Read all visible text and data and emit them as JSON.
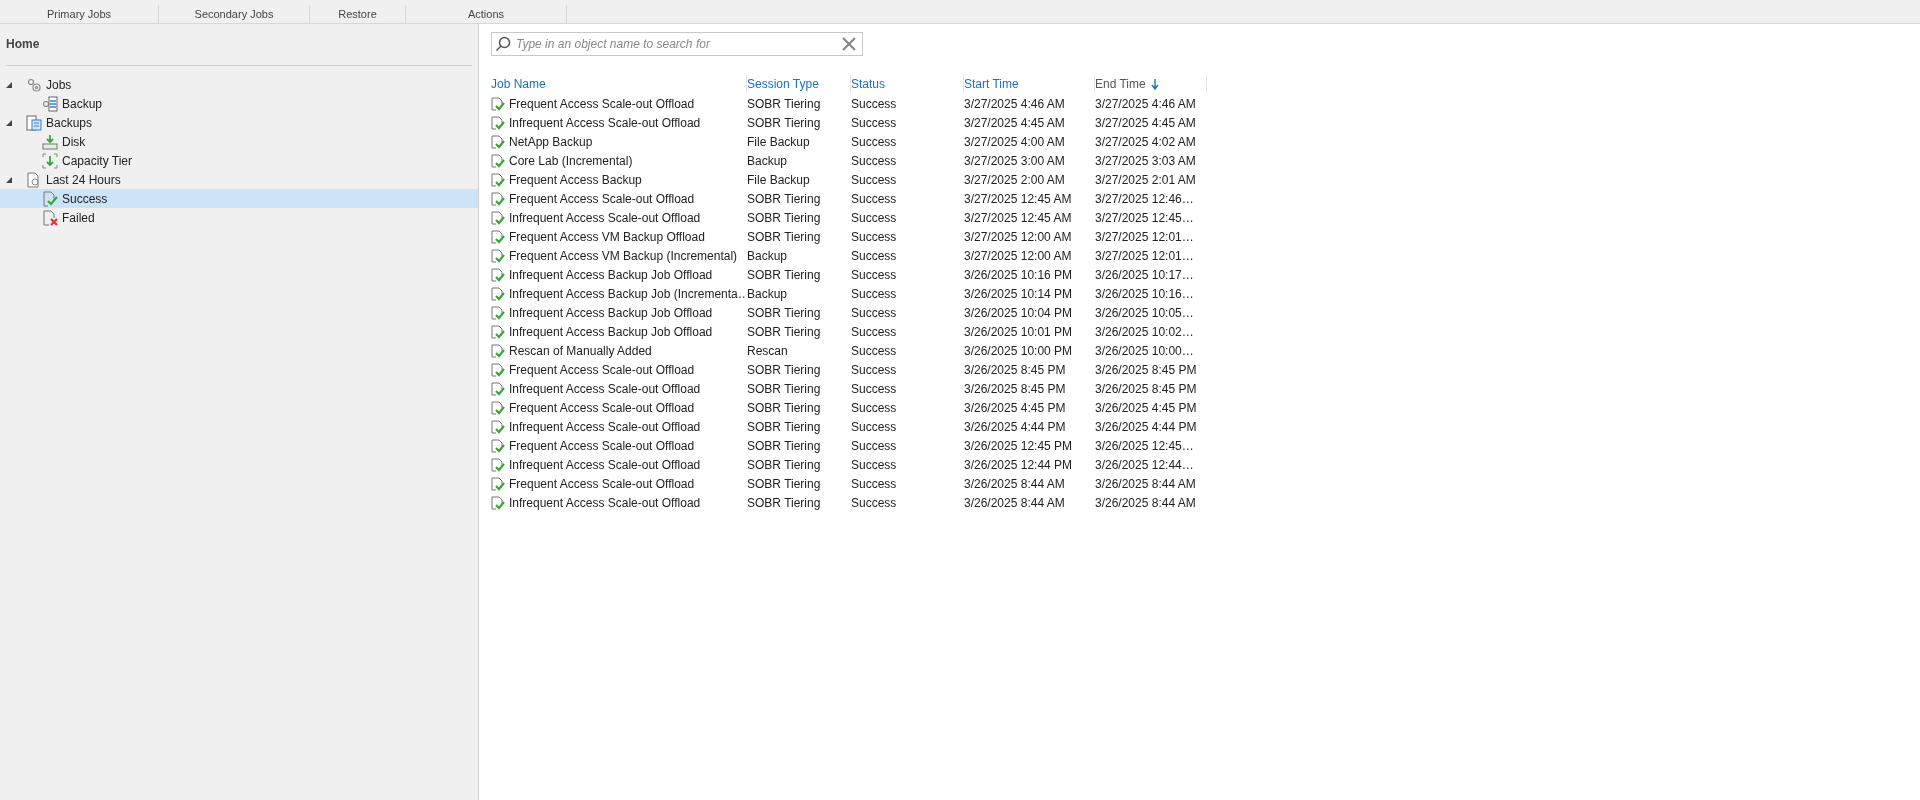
{
  "ribbon": {
    "groups": [
      "Primary Jobs",
      "Secondary Jobs",
      "Restore",
      "Actions"
    ]
  },
  "sidebar": {
    "title": "Home",
    "tree": [
      {
        "label": "Jobs",
        "kind": "jobs",
        "expanded": true,
        "selected": false,
        "children": [
          {
            "label": "Backup",
            "kind": "backup-job",
            "selected": false
          }
        ]
      },
      {
        "label": "Backups",
        "kind": "backups",
        "expanded": true,
        "selected": false,
        "children": [
          {
            "label": "Disk",
            "kind": "disk",
            "selected": false
          },
          {
            "label": "Capacity Tier",
            "kind": "capacity",
            "selected": false
          }
        ]
      },
      {
        "label": "Last 24 Hours",
        "kind": "history",
        "expanded": true,
        "selected": false,
        "children": [
          {
            "label": "Success",
            "kind": "success",
            "selected": true
          },
          {
            "label": "Failed",
            "kind": "failed",
            "selected": false
          }
        ]
      }
    ]
  },
  "search": {
    "placeholder": "Type in an object name to search for"
  },
  "table": {
    "columns": [
      {
        "label": "Job Name",
        "sorted": false
      },
      {
        "label": "Session Type",
        "sorted": false
      },
      {
        "label": "Status",
        "sorted": false
      },
      {
        "label": "Start Time",
        "sorted": false
      },
      {
        "label": "End Time",
        "sorted": true
      }
    ],
    "rows": [
      [
        "Frequent Access Scale-out Offload",
        "SOBR Tiering",
        "Success",
        "3/27/2025 4:46 AM",
        "3/27/2025 4:46 AM"
      ],
      [
        "Infrequent Access Scale-out Offload",
        "SOBR Tiering",
        "Success",
        "3/27/2025 4:45 AM",
        "3/27/2025 4:45 AM"
      ],
      [
        "NetApp Backup",
        "File Backup",
        "Success",
        "3/27/2025 4:00 AM",
        "3/27/2025 4:02 AM"
      ],
      [
        "Core Lab (Incremental)",
        "Backup",
        "Success",
        "3/27/2025 3:00 AM",
        "3/27/2025 3:03 AM"
      ],
      [
        "Frequent Access Backup",
        "File Backup",
        "Success",
        "3/27/2025 2:00 AM",
        "3/27/2025 2:01 AM"
      ],
      [
        "Frequent Access Scale-out Offload",
        "SOBR Tiering",
        "Success",
        "3/27/2025 12:45 AM",
        "3/27/2025 12:46…"
      ],
      [
        "Infrequent Access Scale-out Offload",
        "SOBR Tiering",
        "Success",
        "3/27/2025 12:45 AM",
        "3/27/2025 12:45…"
      ],
      [
        "Frequent Access VM Backup Offload",
        "SOBR Tiering",
        "Success",
        "3/27/2025 12:00 AM",
        "3/27/2025 12:01…"
      ],
      [
        "Frequent Access VM Backup (Incremental)",
        "Backup",
        "Success",
        "3/27/2025 12:00 AM",
        "3/27/2025 12:01…"
      ],
      [
        "Infrequent Access Backup Job Offload",
        "SOBR Tiering",
        "Success",
        "3/26/2025 10:16 PM",
        "3/26/2025 10:17…"
      ],
      [
        "Infrequent Access Backup Job (Incrementa…",
        "Backup",
        "Success",
        "3/26/2025 10:14 PM",
        "3/26/2025 10:16…"
      ],
      [
        "Infrequent Access Backup Job Offload",
        "SOBR Tiering",
        "Success",
        "3/26/2025 10:04 PM",
        "3/26/2025 10:05…"
      ],
      [
        "Infrequent Access Backup Job Offload",
        "SOBR Tiering",
        "Success",
        "3/26/2025 10:01 PM",
        "3/26/2025 10:02…"
      ],
      [
        "Rescan of Manually Added",
        "Rescan",
        "Success",
        "3/26/2025 10:00 PM",
        "3/26/2025 10:00…"
      ],
      [
        "Frequent Access Scale-out Offload",
        "SOBR Tiering",
        "Success",
        "3/26/2025 8:45 PM",
        "3/26/2025 8:45 PM"
      ],
      [
        "Infrequent Access Scale-out Offload",
        "SOBR Tiering",
        "Success",
        "3/26/2025 8:45 PM",
        "3/26/2025 8:45 PM"
      ],
      [
        "Frequent Access Scale-out Offload",
        "SOBR Tiering",
        "Success",
        "3/26/2025 4:45 PM",
        "3/26/2025 4:45 PM"
      ],
      [
        "Infrequent Access Scale-out Offload",
        "SOBR Tiering",
        "Success",
        "3/26/2025 4:44 PM",
        "3/26/2025 4:44 PM"
      ],
      [
        "Frequent Access Scale-out Offload",
        "SOBR Tiering",
        "Success",
        "3/26/2025 12:45 PM",
        "3/26/2025 12:45…"
      ],
      [
        "Infrequent Access Scale-out Offload",
        "SOBR Tiering",
        "Success",
        "3/26/2025 12:44 PM",
        "3/26/2025 12:44…"
      ],
      [
        "Frequent Access Scale-out Offload",
        "SOBR Tiering",
        "Success",
        "3/26/2025 8:44 AM",
        "3/26/2025 8:44 AM"
      ],
      [
        "Infrequent Access Scale-out Offload",
        "SOBR Tiering",
        "Success",
        "3/26/2025 8:44 AM",
        "3/26/2025 8:44 AM"
      ]
    ]
  }
}
